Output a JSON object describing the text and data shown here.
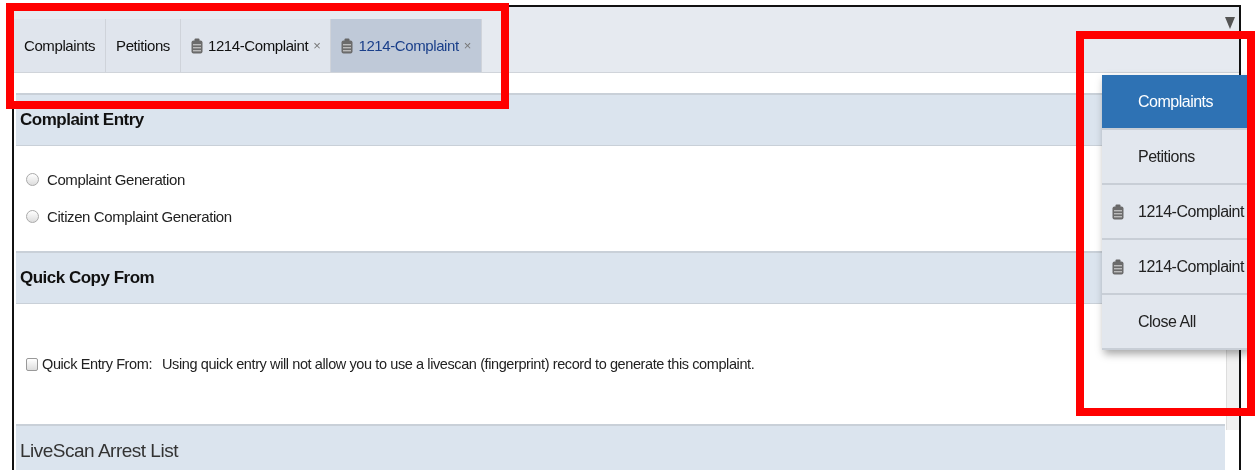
{
  "tabs": [
    {
      "label": "Complaints",
      "kind": "plain",
      "selected": false
    },
    {
      "label": "Petitions",
      "kind": "plain",
      "selected": false
    },
    {
      "label": "1214-Complaint",
      "kind": "document",
      "selected": false,
      "close": "×"
    },
    {
      "label": "1214-Complaint",
      "kind": "document",
      "selected": true,
      "close": "×"
    }
  ],
  "sections": [
    {
      "title": "Complaint Entry",
      "kind": "radios",
      "options": [
        {
          "label": "Complaint Generation",
          "selected": false
        },
        {
          "label": "Citizen Complaint Generation",
          "selected": false
        }
      ]
    },
    {
      "title": "Quick Copy From",
      "kind": "checkbox",
      "checkbox": {
        "label": "Quick Entry From:",
        "checked": false,
        "note": "Using quick entry will not allow you to use a livescan (fingerprint) record to generate this complaint."
      }
    },
    {
      "title": "LiveScan Arrest List",
      "kind": "heading"
    }
  ],
  "tab_menu": {
    "items": [
      {
        "label": "Complaints",
        "kind": "plain",
        "selected": true
      },
      {
        "label": "Petitions",
        "kind": "plain",
        "selected": false
      },
      {
        "label": "1214-Complaint",
        "kind": "document",
        "selected": false
      },
      {
        "label": "1214-Complaint",
        "kind": "document",
        "selected": false
      },
      {
        "label": "Close All",
        "kind": "plain",
        "selected": false
      }
    ]
  }
}
